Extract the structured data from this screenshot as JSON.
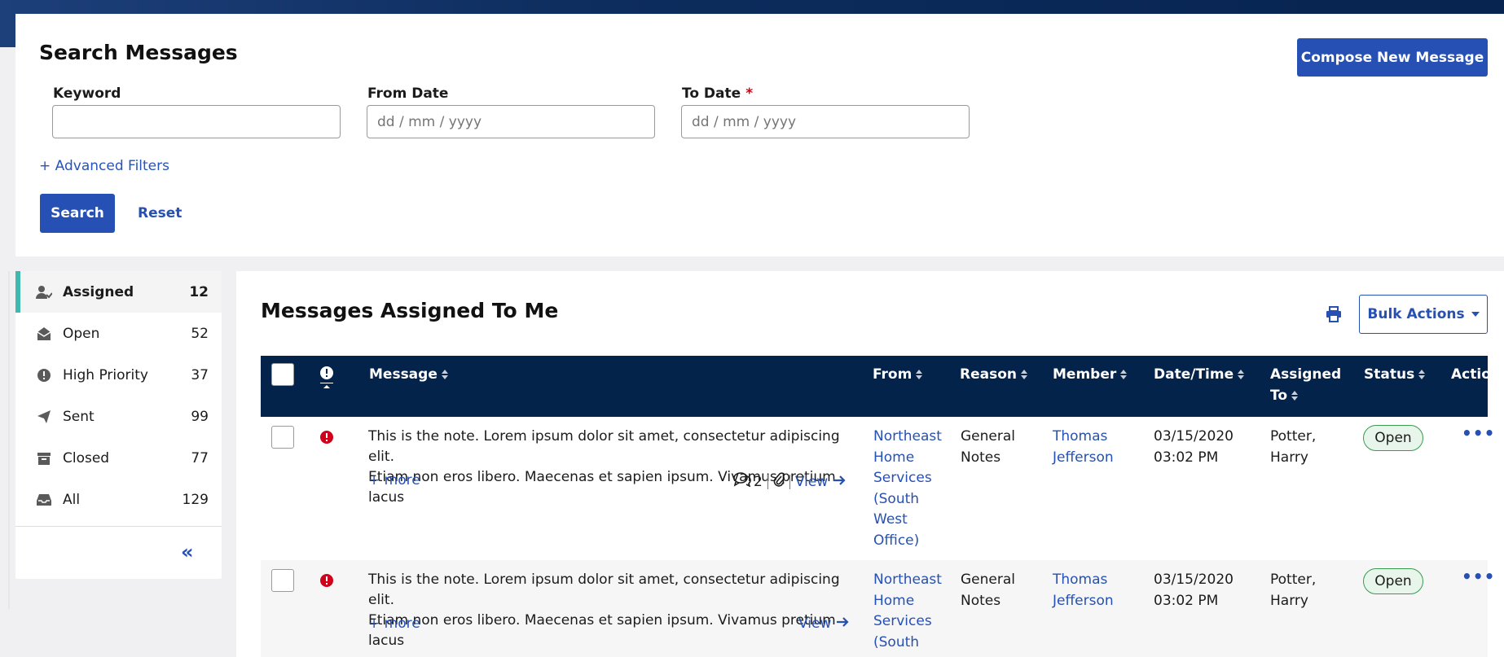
{
  "search": {
    "title": "Search Messages",
    "compose_label": "Compose New Message",
    "keyword_label": "Keyword",
    "keyword_value": "",
    "from_label": "From Date",
    "from_placeholder": "dd / mm / yyyy",
    "to_label": "To Date",
    "to_required": "*",
    "to_placeholder": "dd / mm / yyyy",
    "advanced_filters": "+ Advanced Filters",
    "search_label": "Search",
    "reset_label": "Reset"
  },
  "sidebar": {
    "items": [
      {
        "label": "Assigned",
        "count": "12",
        "icon": "user-assigned-icon"
      },
      {
        "label": "Open",
        "count": "52",
        "icon": "envelope-open-icon"
      },
      {
        "label": "High Priority",
        "count": "37",
        "icon": "exclamation-circle-icon"
      },
      {
        "label": "Sent",
        "count": "99",
        "icon": "paper-plane-icon"
      },
      {
        "label": "Closed",
        "count": "77",
        "icon": "archive-icon"
      },
      {
        "label": "All",
        "count": "129",
        "icon": "inbox-icon"
      }
    ],
    "collapse_glyph": "«"
  },
  "main": {
    "title": "Messages Assigned To Me",
    "bulk_actions": "Bulk Actions",
    "columns": {
      "message": "Message",
      "from": "From",
      "reason": "Reason",
      "member": "Member",
      "datetime": "Date/Time",
      "assigned_line1": "Assigned",
      "assigned_line2": "To",
      "status": "Status",
      "actions": "Actio"
    },
    "rows": [
      {
        "message_line1": "This is the note. Lorem ipsum dolor sit amet, consectetur adipiscing elit.",
        "message_line2": "Etiam non eros libero. Maecenas et sapien ipsum. Vivamus pretium lacus",
        "more": "+ more",
        "comment_count": "2",
        "view": "View",
        "from_lines": [
          "Northeast",
          "Home",
          "Services",
          "(South",
          "West",
          "Office)"
        ],
        "reason_lines": [
          "General",
          "Notes"
        ],
        "member_lines": [
          "Thomas",
          "Jefferson"
        ],
        "datetime_lines": [
          "03/15/2020",
          "03:02 PM"
        ],
        "assigned_lines": [
          "Potter,",
          "Harry"
        ],
        "status": "Open"
      },
      {
        "message_line1": "This is the note. Lorem ipsum dolor sit amet, consectetur adipiscing elit.",
        "message_line2": "Etiam non eros libero. Maecenas et sapien ipsum. Vivamus pretium lacus",
        "more": "+ more",
        "view": "View",
        "from_lines": [
          "Northeast",
          "Home",
          "Services",
          "(South"
        ],
        "reason_lines": [
          "General",
          "Notes"
        ],
        "member_lines": [
          "Thomas",
          "Jefferson"
        ],
        "datetime_lines": [
          "03/15/2020",
          "03:02 PM"
        ],
        "assigned_lines": [
          "Potter,",
          "Harry"
        ],
        "status": "Open"
      }
    ]
  },
  "colors": {
    "primary": "#2650b3",
    "header_bg": "#03234b",
    "accent_teal": "#3fb8b0",
    "priority_red": "#d0021b",
    "status_green": "#3a9a52"
  }
}
